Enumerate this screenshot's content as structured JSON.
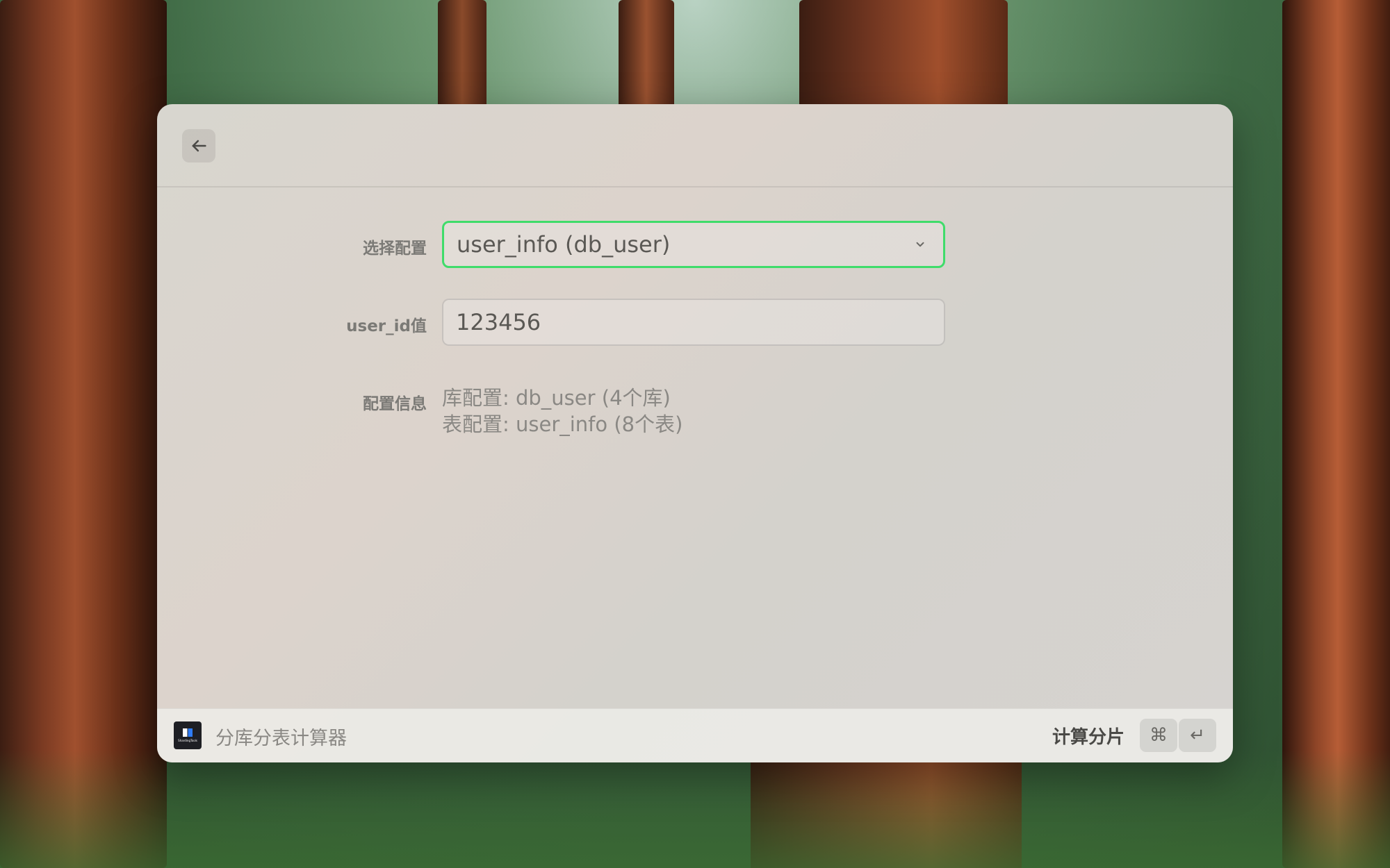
{
  "form": {
    "select_label": "选择配置",
    "select_value": "user_info (db_user)",
    "input_label": "user_id值",
    "input_value": "123456",
    "info_label": "配置信息",
    "info_lines": [
      "库配置: db_user (4个库)",
      "表配置: user_info (8个表)"
    ]
  },
  "footer": {
    "app_name": "分库分表计算器",
    "app_icon_caption": "ShardingTools",
    "primary_action": "计算分片",
    "shortcut_keys": [
      "⌘",
      "↵"
    ]
  },
  "icons": {
    "back": "arrow-left-icon",
    "dropdown": "chevron-down-icon",
    "app": "app-logo-icon"
  },
  "colors": {
    "focus_accent": "#3fdc6a"
  }
}
